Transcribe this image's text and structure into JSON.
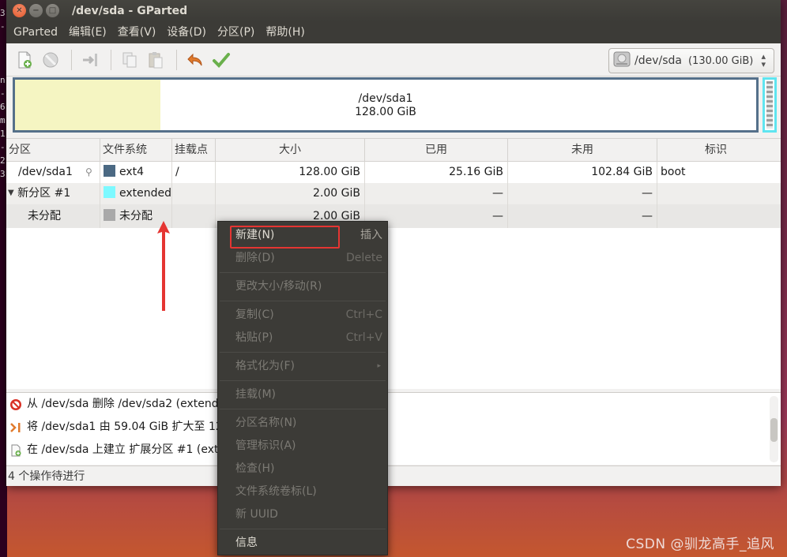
{
  "terminal": {
    "chars": [
      "3",
      "-",
      "",
      "",
      "",
      "n",
      "-",
      "6",
      "m",
      "1",
      "-",
      "2",
      "3"
    ]
  },
  "window": {
    "title": "/dev/sda - GParted"
  },
  "menubar": {
    "items": [
      "GParted",
      "编辑(E)",
      "查看(V)",
      "设备(D)",
      "分区(P)",
      "帮助(H)"
    ]
  },
  "toolbar": {
    "icons": [
      "new-icon",
      "delete-icon",
      "resize-icon",
      "copy-icon",
      "paste-icon",
      "undo-icon",
      "apply-icon"
    ],
    "device": {
      "label": "/dev/sda",
      "size": "(130.00 GiB)",
      "icon": "disk-icon"
    }
  },
  "graph": {
    "label": "/dev/sda1",
    "size": "128.00 GiB"
  },
  "table": {
    "headers": [
      "分区",
      "文件系统",
      "挂载点",
      "大小",
      "已用",
      "未用",
      "标识"
    ],
    "rows": [
      {
        "partition": "/dev/sda1",
        "fs": "ext4",
        "fs_color": "#4b6983",
        "mount": "/",
        "size": "128.00 GiB",
        "used": "25.16 GiB",
        "unused": "102.84 GiB",
        "flags": "boot"
      },
      {
        "partition": "新分区 #1",
        "fs": "extended",
        "fs_color": "#7df9ff",
        "mount": "",
        "size": "2.00 GiB",
        "used": "—",
        "unused": "—",
        "flags": ""
      },
      {
        "partition": "未分配",
        "fs": "未分配",
        "fs_color": "#a9a9a9",
        "mount": "",
        "size": "2.00 GiB",
        "used": "—",
        "unused": "—",
        "flags": ""
      }
    ]
  },
  "log": {
    "lines": [
      {
        "icon": "delete-icon",
        "text": "从 /dev/sda 删除 /dev/sda2 (extend"
      },
      {
        "icon": "resize-icon",
        "text": "将 /dev/sda1 由 59.04 GiB 扩大至 128"
      },
      {
        "icon": "new-icon",
        "text": "在 /dev/sda 上建立 扩展分区 #1 (ext"
      }
    ]
  },
  "status": {
    "text": "4 个操作待进行"
  },
  "context_menu": {
    "items": [
      {
        "label": "新建(N)",
        "accel": "插入",
        "enabled": true
      },
      {
        "label": "删除(D)",
        "accel": "Delete",
        "enabled": false
      },
      {
        "label": "更改大小/移动(R)",
        "accel": "",
        "enabled": false
      },
      {
        "label": "复制(C)",
        "accel": "Ctrl+C",
        "enabled": false
      },
      {
        "label": "粘贴(P)",
        "accel": "Ctrl+V",
        "enabled": false
      },
      {
        "label": "格式化为(F)",
        "accel": "",
        "enabled": false,
        "submenu": true
      },
      {
        "label": "挂载(M)",
        "accel": "",
        "enabled": false
      },
      {
        "label": "分区名称(N)",
        "accel": "",
        "enabled": false
      },
      {
        "label": "管理标识(A)",
        "accel": "",
        "enabled": false
      },
      {
        "label": "检查(H)",
        "accel": "",
        "enabled": false
      },
      {
        "label": "文件系统卷标(L)",
        "accel": "",
        "enabled": false
      },
      {
        "label": "新 UUID",
        "accel": "",
        "enabled": false
      },
      {
        "label": "信息",
        "accel": "",
        "enabled": true
      }
    ]
  },
  "annotation": {
    "color": "#e53532"
  },
  "watermark": {
    "text": "CSDN @驯龙高手_追风"
  }
}
